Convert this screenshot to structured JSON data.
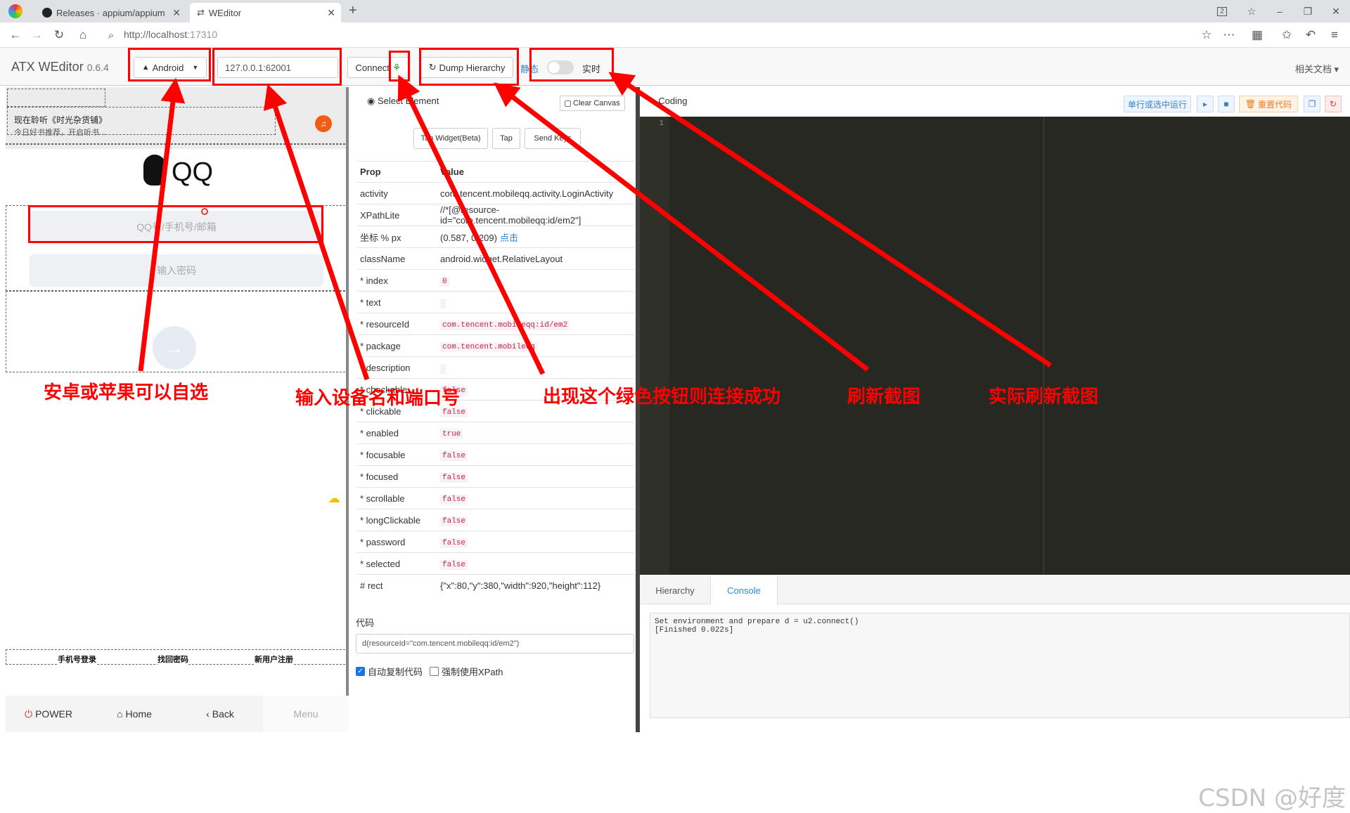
{
  "browser": {
    "tabs": [
      {
        "title": "Releases · appium/appium"
      },
      {
        "title": "WEditor"
      }
    ],
    "url_host": "http://localhost",
    "url_port": ":17310",
    "window_badge": "2"
  },
  "header": {
    "brand": "ATX WEditor",
    "version": "0.6.4",
    "platform": "Android",
    "address": "127.0.0.1:62001",
    "connect_label": "Connect",
    "dump_label": "Dump Hierarchy",
    "static_label": "静态",
    "realtime_label": "实时",
    "docs_label": "相关文档"
  },
  "phone": {
    "banner_line1": "现在聆听《时光杂货铺》",
    "banner_line2": "今日好书推荐，开启听书...",
    "logo": "QQ",
    "account_placeholder": "QQ号/手机号/邮箱",
    "password_placeholder": "输入密码",
    "link_phone": "手机号登录",
    "link_find": "找回密码",
    "link_register": "新用户注册",
    "nav": {
      "power": "POWER",
      "home": "Home",
      "back": "Back",
      "menu": "Menu"
    }
  },
  "inspector": {
    "select_label": "Select Element",
    "clear_label": "Clear Canvas",
    "tap_widget_label": "Tap Widget(Beta)",
    "tap_label": "Tap",
    "send_keys_label": "Send Keys",
    "col_prop": "Prop",
    "col_value": "Value",
    "rows": [
      {
        "k": "activity",
        "v": "com.tencent.mobileqq.activity.LoginActivity",
        "code": false
      },
      {
        "k": "XPathLite",
        "v": "//*[@resource-id=\"com.tencent.mobileqq:id/em2\"]",
        "code": false
      },
      {
        "k": "坐标 % px",
        "v": "(0.587, 0.209)",
        "code": false
      },
      {
        "k": "className",
        "v": "android.widget.RelativeLayout",
        "code": false
      },
      {
        "k": "* index",
        "v": "0",
        "code": true
      },
      {
        "k": "* text",
        "v": "",
        "code": true
      },
      {
        "k": "* resourceId",
        "v": "com.tencent.mobileqq:id/em2",
        "code": true
      },
      {
        "k": "* package",
        "v": "com.tencent.mobileqq",
        "code": true
      },
      {
        "k": "* description",
        "v": "",
        "code": true
      },
      {
        "k": "* checkable",
        "v": "false",
        "code": true
      },
      {
        "k": "* clickable",
        "v": "false",
        "code": true
      },
      {
        "k": "* enabled",
        "v": "true",
        "code": true
      },
      {
        "k": "* focusable",
        "v": "false",
        "code": true
      },
      {
        "k": "* focused",
        "v": "false",
        "code": true
      },
      {
        "k": "* scrollable",
        "v": "false",
        "code": true
      },
      {
        "k": "* longClickable",
        "v": "false",
        "code": true
      },
      {
        "k": "* password",
        "v": "false",
        "code": true
      },
      {
        "k": "* selected",
        "v": "false",
        "code": true
      },
      {
        "k": "# rect",
        "v": "{\"x\":80,\"y\":380,\"width\":920,\"height\":112}",
        "code": false
      }
    ],
    "click_link": "点击",
    "code_label": "代码",
    "code_value": "d(resourceId=\"com.tencent.mobileqq:id/em2\")",
    "auto_copy_label": "自动复制代码",
    "force_xpath_label": "强制使用XPath"
  },
  "coding": {
    "title": "Coding",
    "run_label": "单行或选中运行",
    "reset_label": "重置代码",
    "line_number": "1",
    "tab_hierarchy": "Hierarchy",
    "tab_console": "Console",
    "console_lines": [
      "Set environment and prepare d = u2.connect()",
      "[Finished 0.022s]"
    ]
  },
  "annotations": {
    "platform_note": "安卓或苹果可以自选",
    "address_note": "输入设备名和端口号",
    "connect_note": "出现这个绿色按钮则连接成功",
    "refresh_note": "刷新截图",
    "realtime_note": "实际刷新截图",
    "annotation_color": "#ff0000"
  },
  "watermark": "CSDN @好度"
}
